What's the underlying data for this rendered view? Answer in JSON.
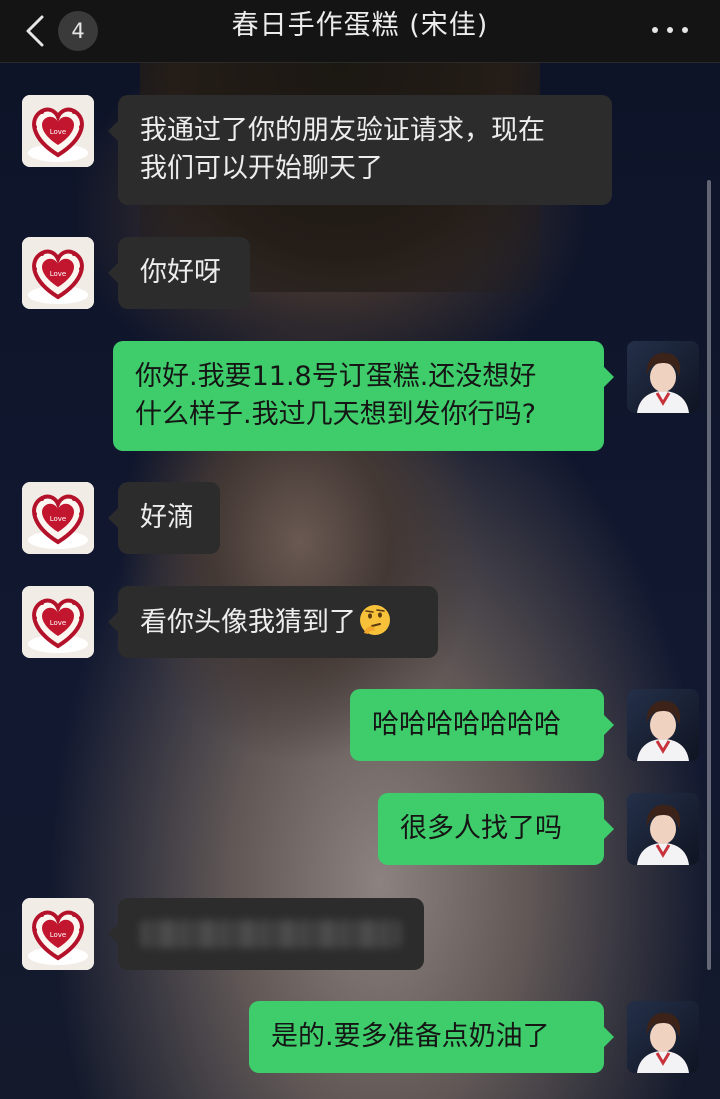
{
  "header": {
    "back_badge": "4",
    "title": "春日手作蛋糕 (宋佳)"
  },
  "messages": [
    {
      "side": "in",
      "avatar": "cake-heart-avatar",
      "lines": [
        "我通过了你的朋友验证请求，现在",
        "我们可以开始聊天了"
      ]
    },
    {
      "side": "in",
      "avatar": "cake-heart-avatar",
      "lines": [
        "你好呀"
      ]
    },
    {
      "side": "out",
      "avatar": "user-portrait-avatar",
      "lines": [
        "你好.我要11.8号订蛋糕.还没想好",
        "什么样子.我过几天想到发你行吗?"
      ]
    },
    {
      "side": "in",
      "avatar": "cake-heart-avatar",
      "lines": [
        "好滴"
      ]
    },
    {
      "side": "in",
      "avatar": "cake-heart-avatar",
      "lines": [
        "看你头像我猜到了"
      ],
      "emoji": "thinking-face-emoji"
    },
    {
      "side": "out",
      "avatar": "user-portrait-avatar",
      "lines": [
        "哈哈哈哈哈哈哈"
      ]
    },
    {
      "side": "out",
      "avatar": "user-portrait-avatar",
      "lines": [
        "很多人找了吗"
      ]
    },
    {
      "side": "in",
      "avatar": "cake-heart-avatar",
      "lines": [],
      "redacted": true
    },
    {
      "side": "out",
      "avatar": "user-portrait-avatar",
      "lines": [
        "是的.要多准备点奶油了"
      ]
    }
  ],
  "colors": {
    "incoming_bubble": "#2c2c2c",
    "outgoing_bubble": "#3fcd6b",
    "topbar": "#141414"
  },
  "avatar_labels": {
    "cake_text": "Love"
  }
}
